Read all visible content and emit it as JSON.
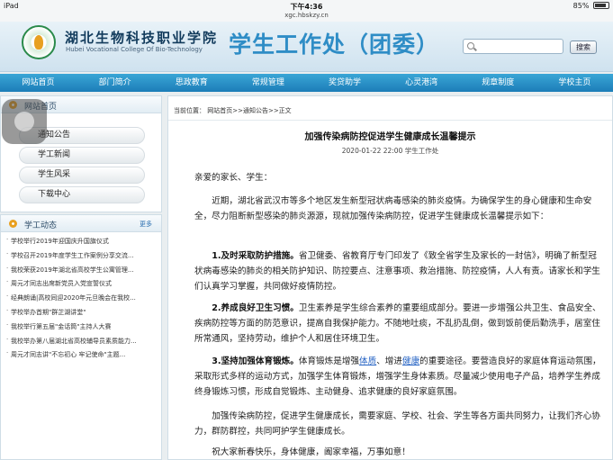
{
  "status_bar": {
    "device": "iPad",
    "time": "下午4:36",
    "url": "xgc.hbskzy.cn",
    "battery": "85%"
  },
  "header": {
    "school_cn": "湖北生物科技职业学院",
    "school_en": "Hubei Vocational College Of Bio-Technology",
    "dept_title": "学生工作处（团委）",
    "search_button": "搜索"
  },
  "nav": [
    "网站首页",
    "部门简介",
    "思政教育",
    "常规管理",
    "奖贷助学",
    "心灵港湾",
    "规章制度",
    "学校主页"
  ],
  "sidebar": {
    "home_box": {
      "title": "网站首页",
      "items": [
        "通知公告",
        "学工新闻",
        "学生风采",
        "下载中心"
      ]
    },
    "news_box": {
      "title": "学工动态",
      "more": "更多",
      "items": [
        "学校举行2019年迎国庆升国旗仪式",
        "学校召开2019年度学生工作案例分享交流...",
        "我校荣获2019年湖北省高校学生公寓管理...",
        "周元才同志出席新党员入党宣誓仪式",
        "经典朗诵|高校同迎2020年元旦晚会在我校...",
        "学校举办首期\"群芷湖讲堂\"",
        "我校举行第五届\"金话筒\"主持人大赛",
        "我校举办第八届湖北省高校辅导员素质能力...",
        "周元才同志讲\"不忘初心 牢记使命\"主题..."
      ]
    }
  },
  "article": {
    "breadcrumb": "当前位置：   网站首页>>通知公告>>正文",
    "title": "加强传染病防控促进学生健康成长温馨提示",
    "meta": "2020-01-22 22:00    学生工作处",
    "greeting": "亲爱的家长、学生：",
    "intro": "近期，湖北省武汉市等多个地区发生新型冠状病毒感染的肺炎疫情。为确保学生的身心健康和生命安全，尽力阻断新型感染的肺炎源源，现就加强传染病防控，促进学生健康成长温馨提示如下：",
    "p1_head": "1.及时采取防护措施。",
    "p1_body": "省卫健委、省教育厅专门印发了《致全省学生及家长的一封信》，明确了新型冠状病毒感染的肺炎的相关防护知识、防控要点、注意事项、救治措施、防控疫情，人人有责。请家长和学生们认真学习掌握，共同做好疫情防控。",
    "p2_head": "2.养成良好卫生习惯。",
    "p2_body": "卫生素养是学生综合素养的重要组成部分。要进一步增强公共卫生、食品安全、疾病防控等方面的防范意识，提高自我保护能力。不随地吐痰，不乱扔乱倒，做到饭前便后勤洗手，居室住所常通风，坚持劳动，维护个人和居住环境卫生。",
    "p3_head": "3.坚持加强体育锻炼。",
    "p3_a": "体育锻炼是增强",
    "p3_link1": "体质",
    "p3_b": "、增进",
    "p3_link2": "健康",
    "p3_c": "的重要途径。要营造良好的家庭体育运动氛围，采取形式多样的运动方式，加强学生体育锻炼，增强学生身体素质。尽量减少使用电子产品，培养学生养成终身锻炼习惯，形成自觉锻炼、主动健身、追求健康的良好家庭氛围。",
    "p4": "加强传染病防控，促进学生健康成长，需要家庭、学校、社会、学生等各方面共同努力，让我们齐心协力，群防群控，共同呵护学生健康成长。",
    "closing": "祝大家新春快乐，身体健康，阖家幸福，万事如意！"
  }
}
